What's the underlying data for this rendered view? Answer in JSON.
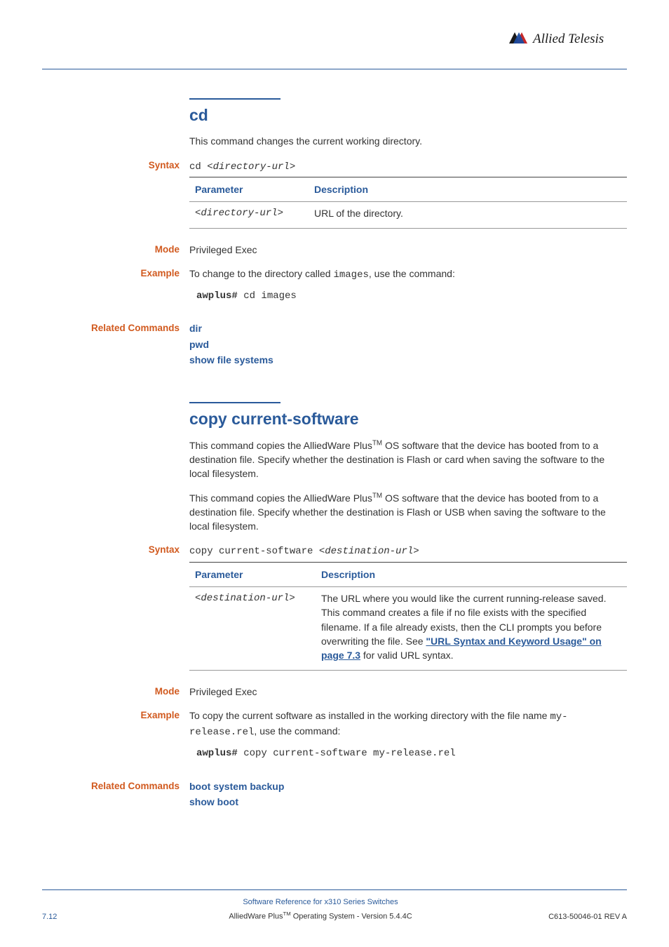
{
  "brand": "Allied Telesis",
  "cd": {
    "title": "cd",
    "desc": "This command changes the current working directory.",
    "syntax_label": "Syntax",
    "syntax_cmd": "cd ",
    "syntax_arg": "<directory-url>",
    "table_h1": "Parameter",
    "table_h2": "Description",
    "param": "<directory-url>",
    "param_desc": "URL of the directory.",
    "mode_label": "Mode",
    "mode_val": "Privileged Exec",
    "example_label": "Example",
    "example_text_pre": "To change to the directory called ",
    "example_text_code": "images",
    "example_text_post": ", use the command:",
    "example_prompt": "awplus#",
    "example_cmd": " cd images",
    "related_label": "Related Commands",
    "related": {
      "r1": "dir",
      "r2": "pwd",
      "r3": "show file systems"
    }
  },
  "copy": {
    "title": "copy current-software",
    "desc1_pre": "This command copies the AlliedWare Plus",
    "desc1_tm": "TM",
    "desc1_post": " OS software that the device has booted from to a destination file. Specify whether the destination is Flash or card when saving the software to the local filesystem.",
    "desc2_pre": "This command copies the AlliedWare Plus",
    "desc2_tm": "TM",
    "desc2_post": " OS software that the device has booted from to a destination file. Specify whether the destination is Flash or USB when saving the software to the local filesystem.",
    "syntax_label": "Syntax",
    "syntax_cmd": "copy current-software ",
    "syntax_arg": "<destination-url>",
    "table_h1": "Parameter",
    "table_h2": "Description",
    "param": "<destination-url>",
    "param_desc_pre": "The URL where you would like the current running-release saved. This command creates a file if no file exists with the specified filename. If a file already exists, then the CLI prompts you before overwriting the file. See ",
    "param_desc_link": "\"URL Syntax and Keyword Usage\" on page 7.3",
    "param_desc_post": " for valid URL syntax.",
    "mode_label": "Mode",
    "mode_val": "Privileged Exec",
    "example_label": "Example",
    "example_text_pre": "To copy the current software as installed in the working directory with the file name ",
    "example_text_code": "my-release.rel",
    "example_text_post": ", use the command:",
    "example_prompt": "awplus#",
    "example_cmd": " copy current-software my-release.rel",
    "related_label": "Related Commands",
    "related": {
      "r1": "boot system backup",
      "r2": "show boot"
    }
  },
  "footer": {
    "page": "7.12",
    "ln1": "Software Reference for x310 Series Switches",
    "ln2_pre": "AlliedWare Plus",
    "ln2_tm": "TM",
    "ln2_post": " Operating System  - Version 5.4.4C",
    "rev": "C613-50046-01 REV A"
  }
}
